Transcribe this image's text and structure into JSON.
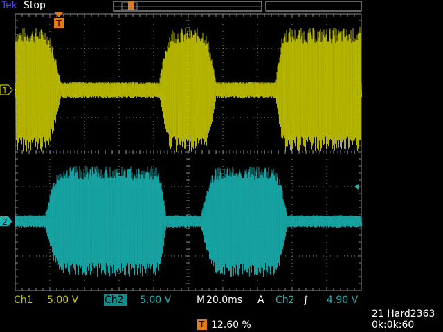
{
  "header": {
    "brand": "Tek",
    "state": "Stop"
  },
  "channels": {
    "ch1_marker": "1",
    "ch2_marker": "2",
    "trigger_marker": "T"
  },
  "status_bar": {
    "ch1_label": "Ch1",
    "ch1_scale": "5.00 V",
    "ch2_label": "Ch2",
    "ch2_scale": "5.00 V",
    "timebase_prefix": "M",
    "timebase": "20.0ms",
    "trigger_mode": "A",
    "trigger_source": "Ch2",
    "trigger_slope": "∫",
    "trigger_level": "4.90 V",
    "trigger_icon": "T",
    "trigger_position": "12.60 %",
    "info_line1": "21 Hard2363",
    "info_line2": "0k:0k:60"
  },
  "colors": {
    "ch1": "#c8c800",
    "ch2": "#1ab4b4",
    "trigger": "#e07a1a",
    "grid": "#8a8a8a",
    "brand": "#4a4ae0"
  }
}
